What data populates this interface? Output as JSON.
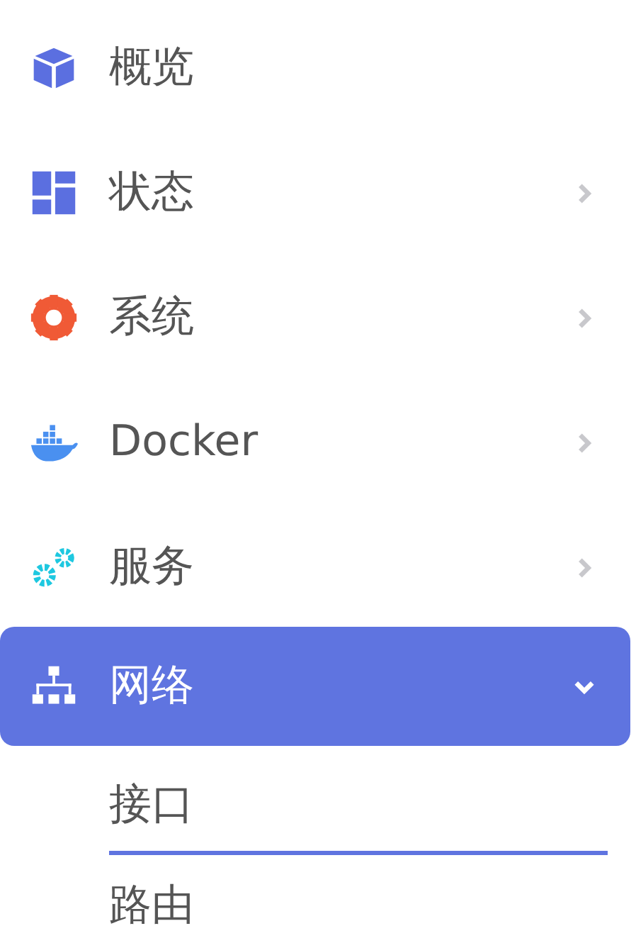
{
  "menu": [
    {
      "label": "概览",
      "kind": "link",
      "selected": false
    },
    {
      "label": "状态",
      "kind": "group",
      "selected": false,
      "expanded": false
    },
    {
      "label": "系统",
      "kind": "group",
      "selected": false,
      "expanded": false
    },
    {
      "label": "Docker",
      "kind": "group",
      "selected": false,
      "expanded": false
    },
    {
      "label": "服务",
      "kind": "group",
      "selected": false,
      "expanded": false
    },
    {
      "label": "网络",
      "kind": "group",
      "selected": true,
      "expanded": true,
      "children": [
        {
          "label": "接口",
          "selected": true
        },
        {
          "label": "路由",
          "selected": false
        }
      ]
    }
  ]
}
